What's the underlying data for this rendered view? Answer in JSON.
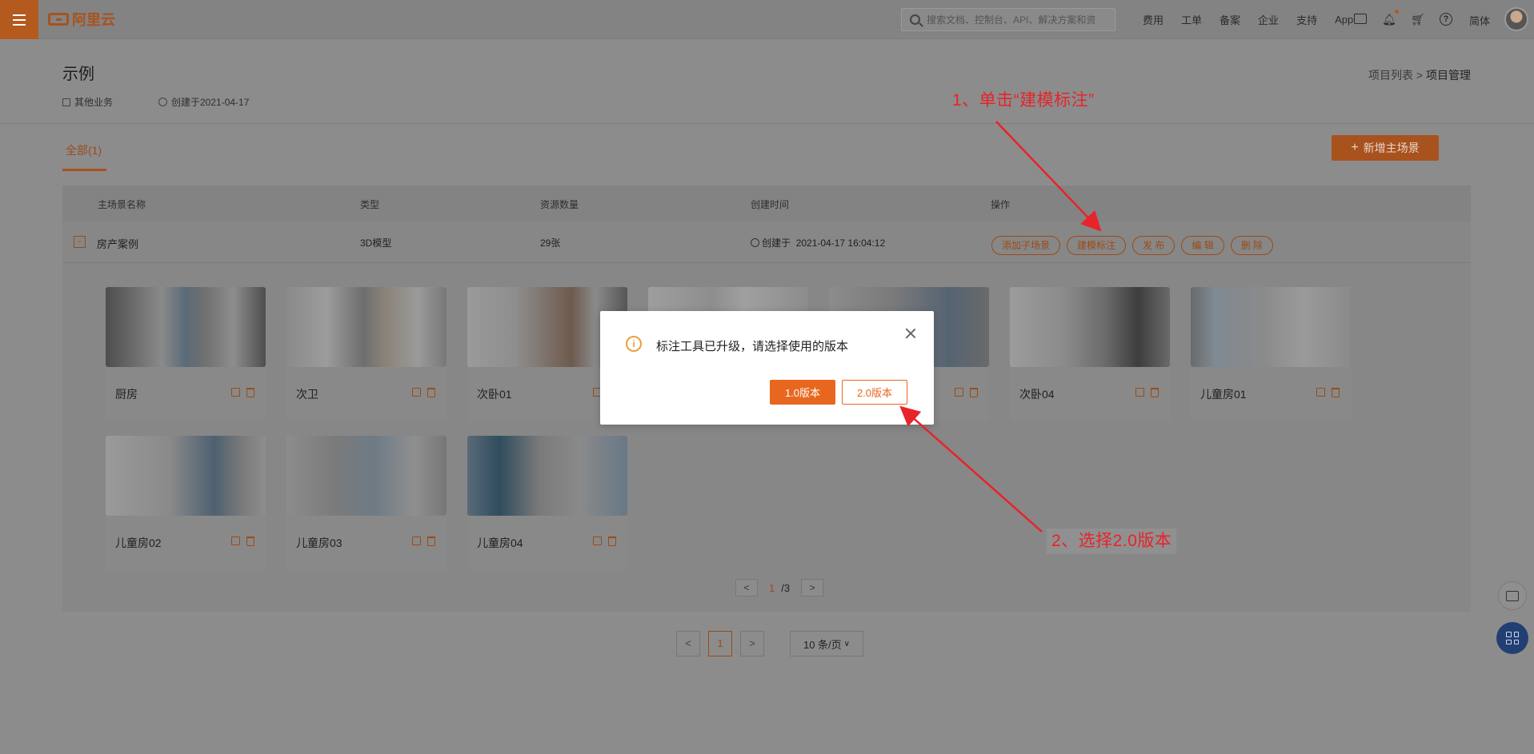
{
  "nav": {
    "brand": "阿里云",
    "search_placeholder": "搜索文档、控制台、API、解决方案和资",
    "links": [
      "费用",
      "工单",
      "备案",
      "企业",
      "支持",
      "App"
    ],
    "lang": "简体",
    "help_glyph": "?"
  },
  "header": {
    "title": "示例",
    "business": "其他业务",
    "created": "创建于2021-04-17",
    "breadcrumb_parent": "项目列表",
    "breadcrumb_sep": ">",
    "breadcrumb_current": "项目管理"
  },
  "tabs": {
    "all": "全部(1)",
    "add_button": "新增主场景",
    "add_plus": "+"
  },
  "table": {
    "columns": [
      "主场景名称",
      "类型",
      "资源数量",
      "创建时间",
      "操作"
    ],
    "row": {
      "toggle": "-",
      "name": "房产案例",
      "type": "3D模型",
      "count": "29张",
      "created_prefix": "创建于",
      "created": "2021-04-17 16:04:12",
      "ops": [
        "添加子场景",
        "建模标注",
        "发 布",
        "编 辑",
        "删 除"
      ]
    }
  },
  "scenes": [
    "厨房",
    "次卫",
    "次卧01",
    "",
    "",
    "次卧04",
    "儿童房01",
    "儿童房02",
    "儿童房03",
    "儿童房04"
  ],
  "inner_pager": {
    "prev": "<",
    "current": "1",
    "total": "/3",
    "next": ">"
  },
  "bottom_pager": {
    "prev": "<",
    "current": "1",
    "next": ">",
    "page_size": "10 条/页"
  },
  "modal": {
    "info_glyph": "i",
    "message": "标注工具已升级，请选择使用的版本",
    "v1": "1.0版本",
    "v2": "2.0版本"
  },
  "annotations": {
    "step1": "1、单击“建模标注”",
    "step2": "2、选择2.0版本"
  },
  "colors": {
    "accent": "#e8671f",
    "annotation": "#e8232a"
  }
}
